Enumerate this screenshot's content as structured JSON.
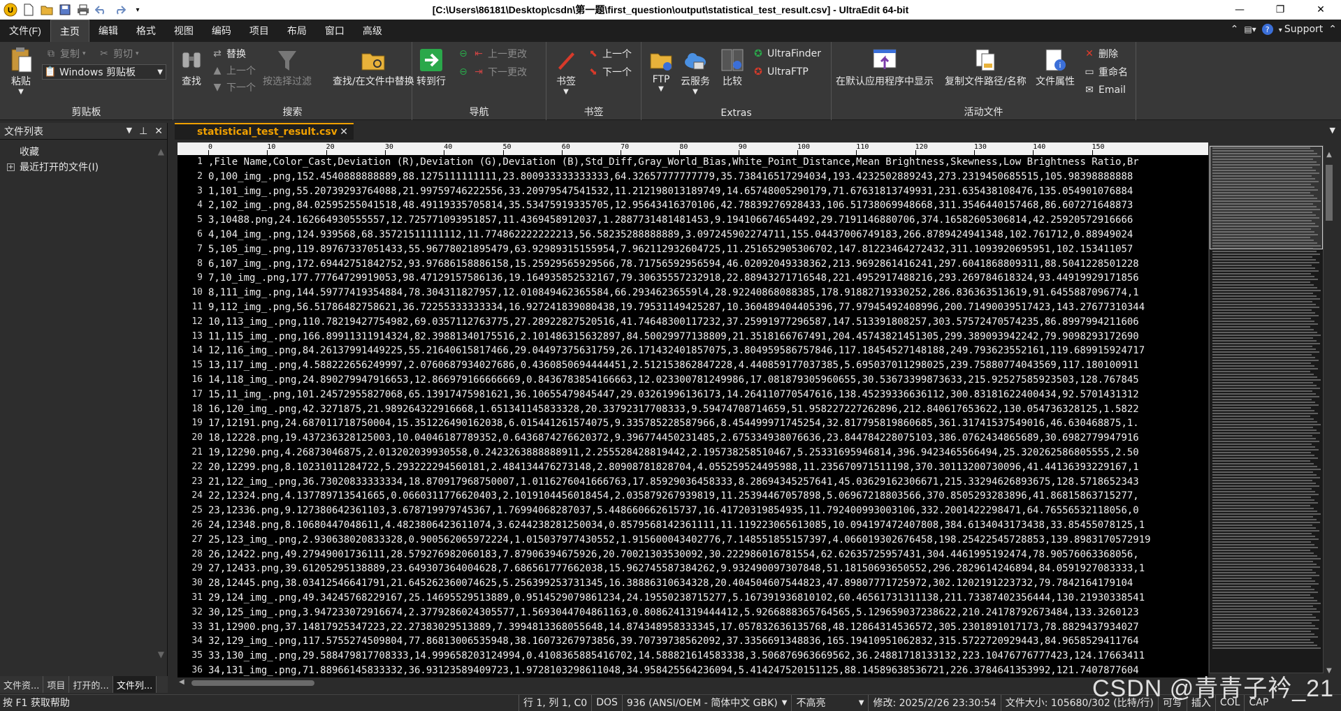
{
  "window": {
    "title": "[C:\\Users\\86181\\Desktop\\csdn\\第一题\\first_question\\output\\statistical_test_result.csv] - UltraEdit 64-bit",
    "minimize": "—",
    "maximize": "❐",
    "close": "✕"
  },
  "menu": {
    "tabs": [
      "文件(F)",
      "主页",
      "编辑",
      "格式",
      "视图",
      "编码",
      "项目",
      "布局",
      "窗口",
      "高级"
    ],
    "active": "主页",
    "support": "Support"
  },
  "ribbon": {
    "clipboard": {
      "label": "剪贴板",
      "paste": "粘贴",
      "copy": "复制",
      "cut": "剪切",
      "board": "Windows 剪贴板"
    },
    "search": {
      "label": "搜索",
      "find": "查找",
      "replace": "替换",
      "prev": "上一个",
      "next": "下一个",
      "filter": "按选择过滤",
      "findinfiles": "查找/在文件中替换"
    },
    "navigate": {
      "label": "导航",
      "goto": "转到行",
      "prevchange": "上一更改",
      "nextchange": "下一更改"
    },
    "bookmark": {
      "label": "书签",
      "bookmark": "书签",
      "prev": "上一个",
      "next": "下一个"
    },
    "extras": {
      "label": "Extras",
      "ftp": "FTP",
      "cloud": "云服务",
      "compare": "比较",
      "finder": "UltraFinder",
      "ultraftp": "UltraFTP"
    },
    "activefile": {
      "label": "活动文件",
      "showin": "在默认应用程序中显示",
      "copypath": "复制文件路径/名称",
      "props": "文件属性",
      "delete": "删除",
      "rename": "重命名",
      "email": "Email"
    }
  },
  "sidebar": {
    "title": "文件列表",
    "items": [
      "收藏",
      "最近打开的文件(I)"
    ],
    "tabs": [
      "文件资...",
      "项目",
      "打开的...",
      "文件列..."
    ],
    "active_tab": "文件列..."
  },
  "editor": {
    "tab": "statistical_test_result.csv",
    "ruler": [
      "0",
      "10",
      "20",
      "30",
      "40",
      "50",
      "60",
      "70",
      "80",
      "90",
      "100",
      "110",
      "120",
      "130",
      "140",
      "150"
    ],
    "lines": [
      ",File Name,Color_Cast,Deviation (R),Deviation (G),Deviation (B),Std_Diff,Gray_World_Bias,White_Point_Distance,Mean Brightness,Skewness,Low Brightness Ratio,Br",
      "0,100_img_.png,152.4540888888889,88.1275111111111,23.800933333333333,64.32657777777779,35.73841651729403­4,193.4232502889243,273.2319450685515,105.98398888888",
      "1,101_img_.png,55.20739293764088,21.99759746222556,33.20979547541532,11.212198013189749,14.65748005290179,71.67631813749931,231.635438108476,135.054901076884",
      "2,102_img_.png,84.02595255041518,48.49119335705814,35.53475919335705,12.95643416370106,42.78839276928433,106.51738069948668,311.3546440157468,86.607271648873",
      "3,10488.png,24.162664930555557,12.725771093951857,11.4369458912037,1.2887731481481453,9.194106674654492,29.7191146880706,374.16582605306814,42.25920572916666",
      "4,104_img_.png,124.939568,68.35721511111112,11.774862222222213,56.58235288888889,3.097245902274711,155.04437006749183,266.8789424941348,102.761712,0.88949024",
      "5,105_img_.png,119.89767337051433,55.96778021895479,63.92989315155954,7.962112932604725,11.251652905306702,147.81223464272432,311.1093920695951,102.153411057",
      "6,107_img_.png,172.69442751842752,93.97686158886158,15.25929565929566,78.71756592956594,46.02092049338362,213.9692861416241,297.6041868809311,88.5041228501228",
      "7,10_img_.png,177.77764729919053,98.47129157586136,19.164935852532167,79.30635557232918,22.88943271716548,221.4952917488216,293.269784618324,93.44919929171856",
      "8,111_img_.png,144.59777419354884,78.304311827957,12.010849462365584,66.29346236559l4,28.92240868088385,178.91882719330252,286.836363513619,91.6455887096774,1",
      "9,112_img_.png,56.51786482758621,36.72255333333334,16.927241839080438,19.79531149425287,10.360489404405396,77.97945492408996,200.71490039517423,143.27677310344",
      "10,113_img_.png,110.78219427754982,69.0357112763775,27.28922827520516,41.74648300117232,37.25991977296587,147.513391808257,303.57572470574235,86.8997994211606",
      "11,115_img_.png,166.89911311914324,82.39881340175516,2.101486315632897,84.50029977138809,21.3518166767491,204.4574382145130­5,299.389093942242,79.9098293172690",
      "12,116_img_.png,84.26137991449225,55.21640615817466,29.04497375631759,26.171432401857075,3.804959586757846,117.18454527148188,249.793623552161,119.689915924717",
      "13,117_img_.png,4.588222656249997,2.0760687934027686,0.4360850694444451,2.512153862847228,4.440859177037385,5.695037011298025,239.75880774043569,117.180100911",
      "14,118_img_.png,24.890279947916653,12.866979166666669,0.8436783854166663,12.023300781249986,17.081879305960655,30.53673399873633,215.92527585923503,128.767845",
      "15,11_img_.png,101.24572955827068,65.13917475981621,36.10655479845447,29.03261996136173,14.264110770547616,138.45239336636112,300.8318162240043­4,92.5701431312",
      "16,120_img_.png,42.3271875,21.989264322916668,1.651341145833328,20.33792317708333,9.59474708714659,51.958227227262896,212.840617653622,130.054736328125,1.5822",
      "17,12191.png,24.687011718750004,15.351226490162038,6.015441261574075,9.335785228587966,8.454499971745254,32.81779581986068­5,361.31741537549016,46.630468875,1.",
      "18,12228.png,19.437236328125003,10.04046187789352,0.6436874276620372,9.396774450231485,2.675334938076636,23.844784228075103,386.0762434865689,30.6982779947916",
      "19,12290.png,4.26873046875,2.013202039930558,0.2423263888888911,2.255528428819442,2.195738258510467,5.253316959468­14,396.9423465566494,25.320262586805555,2.50",
      "20,12299.png,8.10231011284722,5.293222294560181,2.484134476273148,2.80908781828704,4.055259524495988,11.235670971511198,370.30113200730096,41.44136393229167,1",
      "21,122_img_.png,36.73020833333334,18.870917968750007,1.0116276041666763,17.85929036458333,8.28694345257641,45.03629162306671,215.33294626893675,128.5718652343",
      "22,12324.png,4.137789713541665,0.0660311776620403,2.1019104456018454,2.035879267939819,11.25394467057898,5.06967218803566,370.8505293283896,41.868158637152­77,",
      "23,12336.png,9.127380642361103,3.678719979745367,1.76994068287037,5.448660662615737,16.41720319854935,11.792400993003106,332.2001422298471,64.76556532118056,0",
      "24,12348.png,8.10680447048611,4.4823806423611074,3.6244238281250034,0.8579568142361111,11.119223065613085,10.094197472407808,384.6134043173438,33.85455078125,1",
      "25,123_img_.png,2.930638020833328,0.900562065972224,1.015037977430552,1.915600043402776,7.148551855157397,4.066019302676458,198.25422545728853,139.8983170572919",
      "26,12422.png,49.27949001736111,28.579276982060183,7.87906394675926,20.70021303530092,30.222986016781554,62.62635725957431,304.4461995192474,78.9057606336805­6,",
      "27,12433.png,39.61205295138889,23.649307364004628,7.686561777662038,15.962745587384262,9.932490097307848,51.18150693650552,296.2829614246894,84.0591927083333,1",
      "28,12445.png,38.03412546641791,21.645262360074625,5.256399253731345,16.38886310634328,20.404504607544823,47.89807771725972,302.1202191223732,79.7842164179104",
      "29,124_img_.png,49.34245768229167,25.14695529513889,0.9514529079861234,24.19550238715277,5.167391936810102,60.46561731311138,211.73387402356444,130.21930338541",
      "30,125_img_.png,3.947233072916674,2.3779286024305577,1.5693044704861163,0.8086241319444412,5.926688836576456­5,5.129659037238622,210.24178792673484,133.3260123",
      "31,12900.png,37.14817925347223,22.27383029513889,7.399481336805564­8,14.874348958333345,17.057832636135768,48.12864314536572,305.2301891017173,78.882943793402­7",
      "32,129_img_.png,117.57552745098­04,77.86813006535948,38.16073267973856,39.70739738562092,37.3356691348836,165.19410951062832,315.5722720929443­,84.9658529411764",
      "33,130_img_.png,29.588479817708333,14.999658203124994,0.4108365885416702,14.588821614583338,3.506876963669562,36.24881718133132,223.10476776777423,124.17663411",
      "34,131_img_.png,71.88966145833332,36.93123589409723,1.9728103298611048,34.958425564236094,5.414247520151125,88.14589638536721,226.3784641353992,121.7407877604"
    ]
  },
  "statusbar": {
    "help": "按 F1 获取帮助",
    "position": "行 1, 列 1, C0",
    "lineend": "DOS",
    "codepage": "936 (ANSI/OEM - 简体中文 GBK)",
    "highlight": "不高亮",
    "modified": "修改:   2025/2/26 23:30:54",
    "filesize": "文件大小:  105680/302  (比特/行)",
    "rw": "可写",
    "insert": "插入",
    "col": "COL",
    "cap": "CAP"
  },
  "watermark": "CSDN @青青子衿_21"
}
